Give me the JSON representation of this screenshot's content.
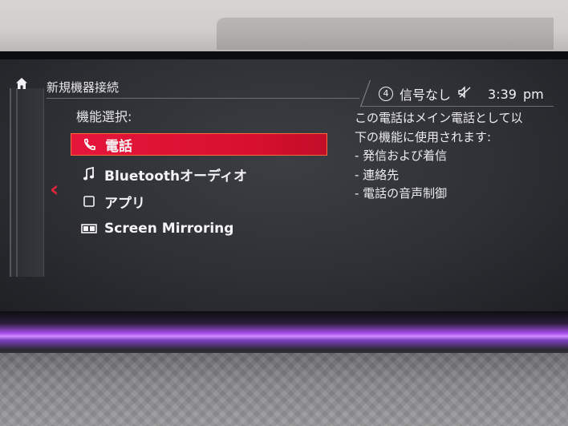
{
  "header": {
    "title": "新規機器接続"
  },
  "status": {
    "source_number": "4",
    "signal_text": "信号なし",
    "mute_icon": "speaker-mute-icon",
    "time": "3:39",
    "ampm": "pm"
  },
  "section_label": "機能選択:",
  "items": [
    {
      "label": "電話",
      "icon": "phone-icon",
      "selected": true
    },
    {
      "label": "Bluetoothオーディオ",
      "icon": "music-note-icon",
      "selected": false
    },
    {
      "label": "アプリ",
      "icon": "app-square-icon",
      "selected": false
    },
    {
      "label": "Screen Mirroring",
      "icon": "screen-mirroring-icon",
      "selected": false
    }
  ],
  "description": {
    "lines": [
      "この電話はメイン電話として以",
      "下の機能に使用されます:",
      "- 発信および着信",
      "- 連絡先",
      "- 電話の音声制御"
    ]
  },
  "colors": {
    "accent_red": "#e5163a",
    "ambient_purple": "#b46cff"
  }
}
